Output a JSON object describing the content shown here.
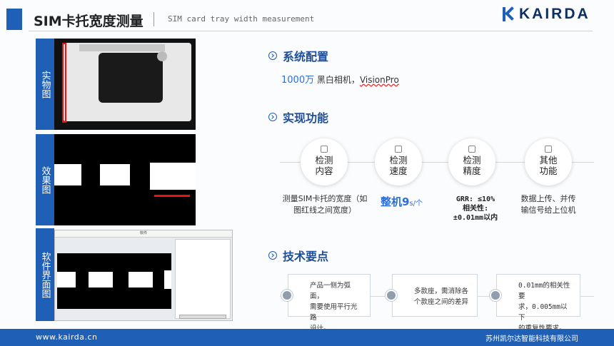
{
  "header": {
    "title_cn": "SIM卡托宽度测量",
    "title_en": "SIM card tray width measurement",
    "logo": "KAIRDA"
  },
  "sidebar": {
    "tabs": [
      "实物图",
      "效果图",
      "软件界面图"
    ]
  },
  "software_panel": {
    "title": "软件"
  },
  "sections": {
    "config": {
      "title": "系统配置",
      "highlight": "1000万",
      "text": "黑白相机，",
      "brand": "VisionPro"
    },
    "functions": {
      "title": "实现功能",
      "items": [
        {
          "icon": "document-icon",
          "label_1": "检测",
          "label_2": "内容",
          "desc_1": "测量SIM卡托的宽度（如",
          "desc_2": "图红线之间宽度）"
        },
        {
          "icon": "rocket-icon",
          "label_1": "检测",
          "label_2": "速度",
          "speed": "整机9",
          "speed_unit": "s/个"
        },
        {
          "icon": "ruler-icon",
          "label_1": "检测",
          "label_2": "精度",
          "precision_1": "GRR: ≤10%",
          "precision_2": "相关性:",
          "precision_3": "±0.01mm以内"
        },
        {
          "icon": "shield-icon",
          "label_1": "其他",
          "label_2": "功能",
          "desc_1": "数据上传、并传",
          "desc_2": "输信号给上位机"
        }
      ]
    },
    "key_points": {
      "title": "技术要点",
      "items": [
        {
          "icon": "search-icon",
          "line_1": "产品一侧为弧面，",
          "line_2": "需要使用平行光路",
          "line_3": "设计。"
        },
        {
          "icon": "clock-icon",
          "line_1": "多款座，需消除各",
          "line_2": "个款座之间的差异",
          "line_3": ""
        },
        {
          "icon": "link-icon",
          "line_1": "0.01mm的相关性要",
          "line_2": "求，0.005mm以下",
          "line_3": "的重复性要求。"
        }
      ]
    }
  },
  "footer": {
    "website": "www.kairda.cn",
    "company": "苏州凯尔达智能科技有限公司"
  },
  "colors": {
    "primary": "#1f5fb5",
    "accent": "#2a6ed8",
    "marker": "#e11111"
  }
}
